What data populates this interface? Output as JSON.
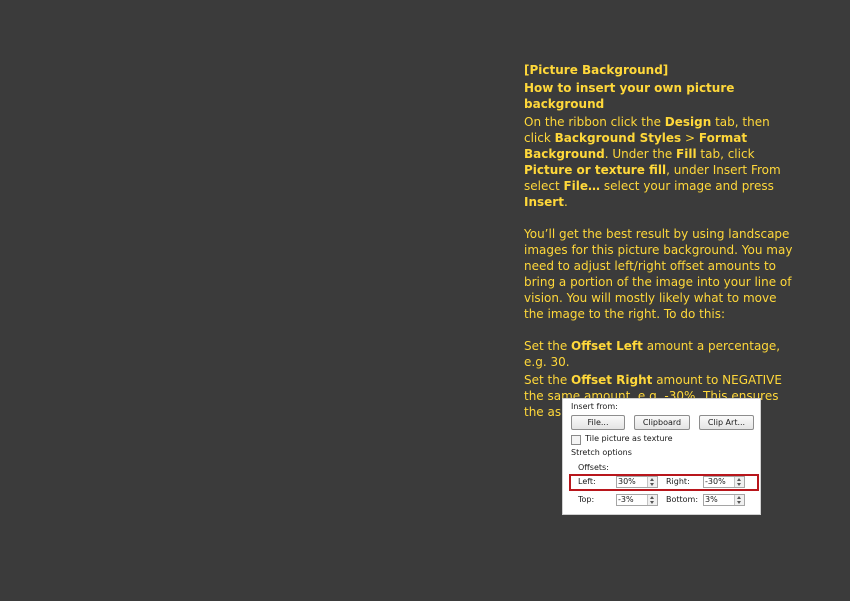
{
  "instructions": {
    "section_tag": "[Picture Background]",
    "heading": "How to insert your own picture background",
    "p1": {
      "t1": "On the ribbon click the ",
      "design": "Design",
      "t2": " tab, then click ",
      "bg_styles": "Background Styles",
      "t3": " > ",
      "format_bg": "Format Background",
      "t4": ". Under the ",
      "fill": "Fill",
      "t5": " tab, click ",
      "pic_fill": "Picture or texture fill",
      "t6": ", under Insert From select ",
      "file": "File…",
      "t7": " select your image and press ",
      "insert": "Insert",
      "t8": "."
    },
    "p2": "You’ll get the best result by using landscape images for this picture background. You may need to adjust  left/right offset amounts to bring a portion of the image into your line of vision. You will mostly likely what to move the image to the right. To do this:",
    "p3": {
      "t1": "Set the ",
      "offset_left": "Offset Left",
      "t2": " amount a percentage,  e.g. 30."
    },
    "p4": {
      "t1": "Set the ",
      "offset_right": "Offset Right",
      "t2": " amount to NEGATIVE the same amount, e.g. -30%. This ensures the aspect ratio remains in tact."
    }
  },
  "dialog": {
    "insert_from": "Insert from:",
    "file_button": "File...",
    "clipboard_button": "Clipboard",
    "clipart_button": "Clip Art...",
    "tile_label": "Tile picture as texture",
    "stretch_options": "Stretch options",
    "offsets": "Offsets:",
    "left_label": "Left:",
    "left_value": "30%",
    "right_label": "Right:",
    "right_value": "-30%",
    "top_label": "Top:",
    "top_value": "-3%",
    "bottom_label": "Bottom:",
    "bottom_value": "3%",
    "highlight_color": "#b8161c"
  },
  "colors": {
    "background": "#3b3b3b",
    "text": "#ffd83a"
  }
}
